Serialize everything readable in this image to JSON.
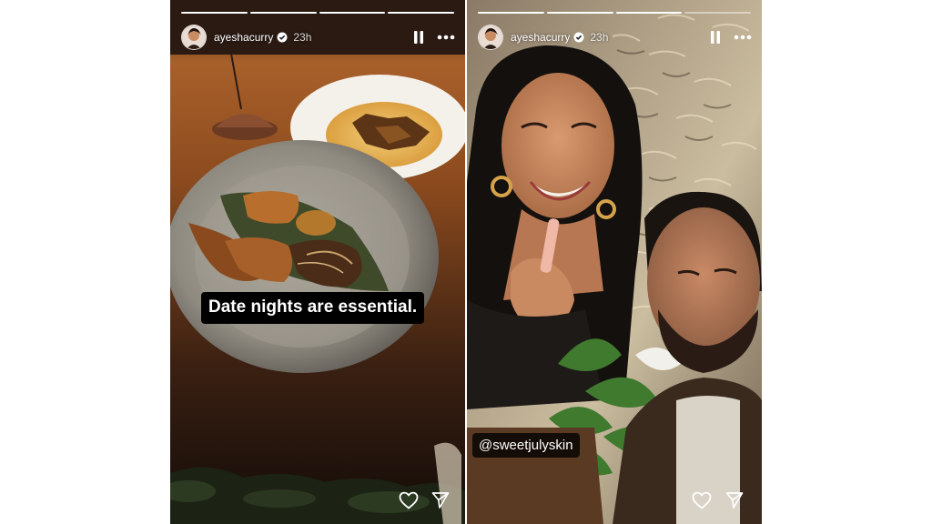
{
  "stories": [
    {
      "progress": [
        1,
        1,
        1,
        1
      ],
      "username": "ayeshacurry",
      "time": "23h",
      "caption": "Date nights are essential.",
      "icons": {
        "verified": "verified-badge-icon",
        "pause": "pause-icon",
        "more": "more-options-icon",
        "like": "heart-icon",
        "share": "send-icon"
      }
    },
    {
      "progress": [
        1,
        1,
        1,
        0
      ],
      "username": "ayeshacurry",
      "time": "23h",
      "mention": "@sweetjulyskin",
      "icons": {
        "verified": "verified-badge-icon",
        "pause": "pause-icon",
        "more": "more-options-icon",
        "like": "heart-icon",
        "share": "send-icon"
      }
    }
  ],
  "colors": {
    "background": "#ffffff",
    "caption_bg": "#000000",
    "text": "#ffffff"
  }
}
